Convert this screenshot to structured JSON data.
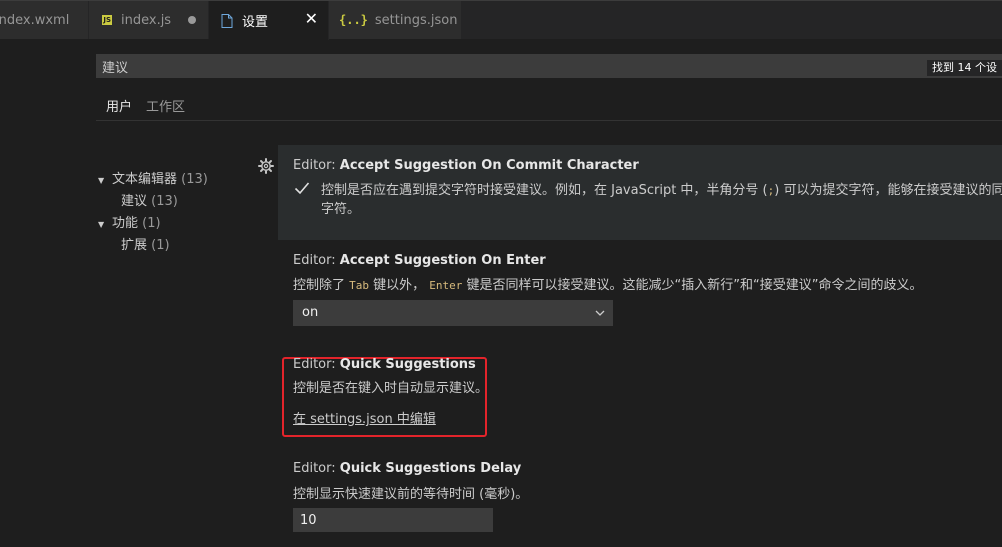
{
  "tabs": [
    {
      "label": "index.wxml",
      "kind": "wxml"
    },
    {
      "label": "index.js",
      "kind": "js",
      "icon_text": "JS",
      "dirty": true
    },
    {
      "label": "设置",
      "kind": "settings",
      "active": true
    },
    {
      "label": "settings.json",
      "kind": "json",
      "icon_text": "{..}"
    }
  ],
  "search": {
    "value": "建议",
    "result_count": "找到 14 个设"
  },
  "scope_tabs": [
    {
      "label": "用户",
      "active": true
    },
    {
      "label": "工作区",
      "active": false
    }
  ],
  "toc": [
    {
      "label": "文本编辑器",
      "count": "(13)",
      "expanded": true
    },
    {
      "label": "建议",
      "count": "(13)"
    },
    {
      "label": "功能",
      "count": "(1)",
      "expanded": true
    },
    {
      "label": "扩展",
      "count": "(1)"
    }
  ],
  "settings": [
    {
      "category": "Editor: ",
      "name": "Accept Suggestion On Commit Character",
      "desc_prefix": "控制是否应在遇到提交字符时接受建议。例如，在 JavaScript 中，半角分号 (",
      "desc_code": ";",
      "desc_suffix": ") 可以为提交字符，能够在接受建议的同时",
      "desc_line2": "字符。",
      "checked": true
    },
    {
      "category": "Editor: ",
      "name": "Accept Suggestion On Enter",
      "desc_part1": "控制除了 ",
      "desc_code1": "Tab",
      "desc_part2": " 键以外， ",
      "desc_code2": "Enter",
      "desc_part3": " 键是否同样可以接受建议。这能减少“插入新行”和“接受建议”命令之间的歧义。",
      "select_value": "on"
    },
    {
      "category": "Editor: ",
      "name": "Quick Suggestions",
      "desc": "控制是否在键入时自动显示建议。",
      "link": "在 settings.json 中编辑"
    },
    {
      "category": "Editor: ",
      "name": "Quick Suggestions Delay",
      "desc": "控制显示快速建议前的等待时间 (毫秒)。",
      "value": "10"
    }
  ],
  "colors": {
    "highlight_box": "#e3242b",
    "js_icon": "#cbcb41"
  }
}
